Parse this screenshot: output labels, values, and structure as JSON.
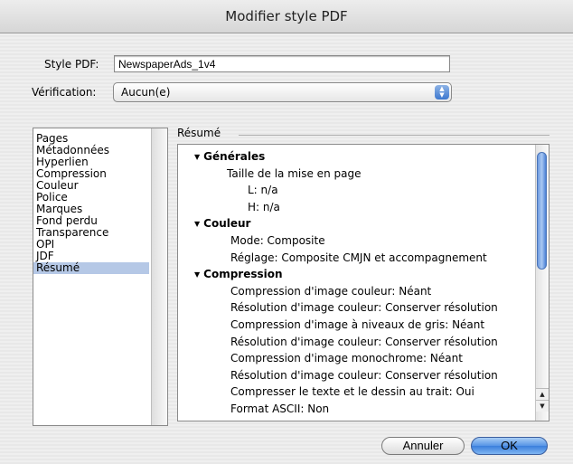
{
  "window": {
    "title": "Modifier style PDF"
  },
  "form": {
    "style_label": "Style PDF:",
    "style_value": "NewspaperAds_1v4",
    "verification_label": "Vérification:",
    "verification_value": "Aucun(e)"
  },
  "sidebar": {
    "items": [
      {
        "label": "Pages"
      },
      {
        "label": "Métadonnées"
      },
      {
        "label": "Hyperlien"
      },
      {
        "label": "Compression"
      },
      {
        "label": "Couleur"
      },
      {
        "label": "Police"
      },
      {
        "label": "Marques"
      },
      {
        "label": "Fond perdu"
      },
      {
        "label": "Transparence"
      },
      {
        "label": "OPI"
      },
      {
        "label": "JDF"
      },
      {
        "label": "Résumé",
        "selected": true
      }
    ]
  },
  "summary": {
    "group_label": "Résumé",
    "lines": [
      {
        "text": "Générales",
        "heading": true
      },
      {
        "text": "Taille de la mise en page",
        "indent": 2
      },
      {
        "text": "L: n/a",
        "indent": 3
      },
      {
        "text": "H: n/a",
        "indent": 3
      },
      {
        "text": "Couleur",
        "heading": true
      },
      {
        "text": "Mode: Composite",
        "indent": 1
      },
      {
        "text": "Réglage: Composite CMJN et accompagnement",
        "indent": 1
      },
      {
        "text": "Compression",
        "heading": true
      },
      {
        "text": "Compression d'image couleur: Néant",
        "indent": 1
      },
      {
        "text": "Résolution d'image couleur: Conserver résolution",
        "indent": 1
      },
      {
        "text": "Compression d'image à niveaux de gris: Néant",
        "indent": 1
      },
      {
        "text": "Résolution d'image couleur: Conserver résolution",
        "indent": 1
      },
      {
        "text": "Compression d'image monochrome: Néant",
        "indent": 1
      },
      {
        "text": "Résolution d'image couleur: Conserver résolution",
        "indent": 1
      },
      {
        "text": "Compresser le texte et le dessin au trait: Oui",
        "indent": 1
      },
      {
        "text": "Format ASCII: Non",
        "indent": 1
      }
    ],
    "scroll_position": 0.05
  },
  "buttons": {
    "cancel": "Annuler",
    "ok": "OK"
  },
  "icons": {
    "disclosure": "disclosure-triangle-icon",
    "popup": "popup-arrows-icon"
  },
  "colors": {
    "selection": "#b5c8e6",
    "accent": "#3b7fdc"
  }
}
